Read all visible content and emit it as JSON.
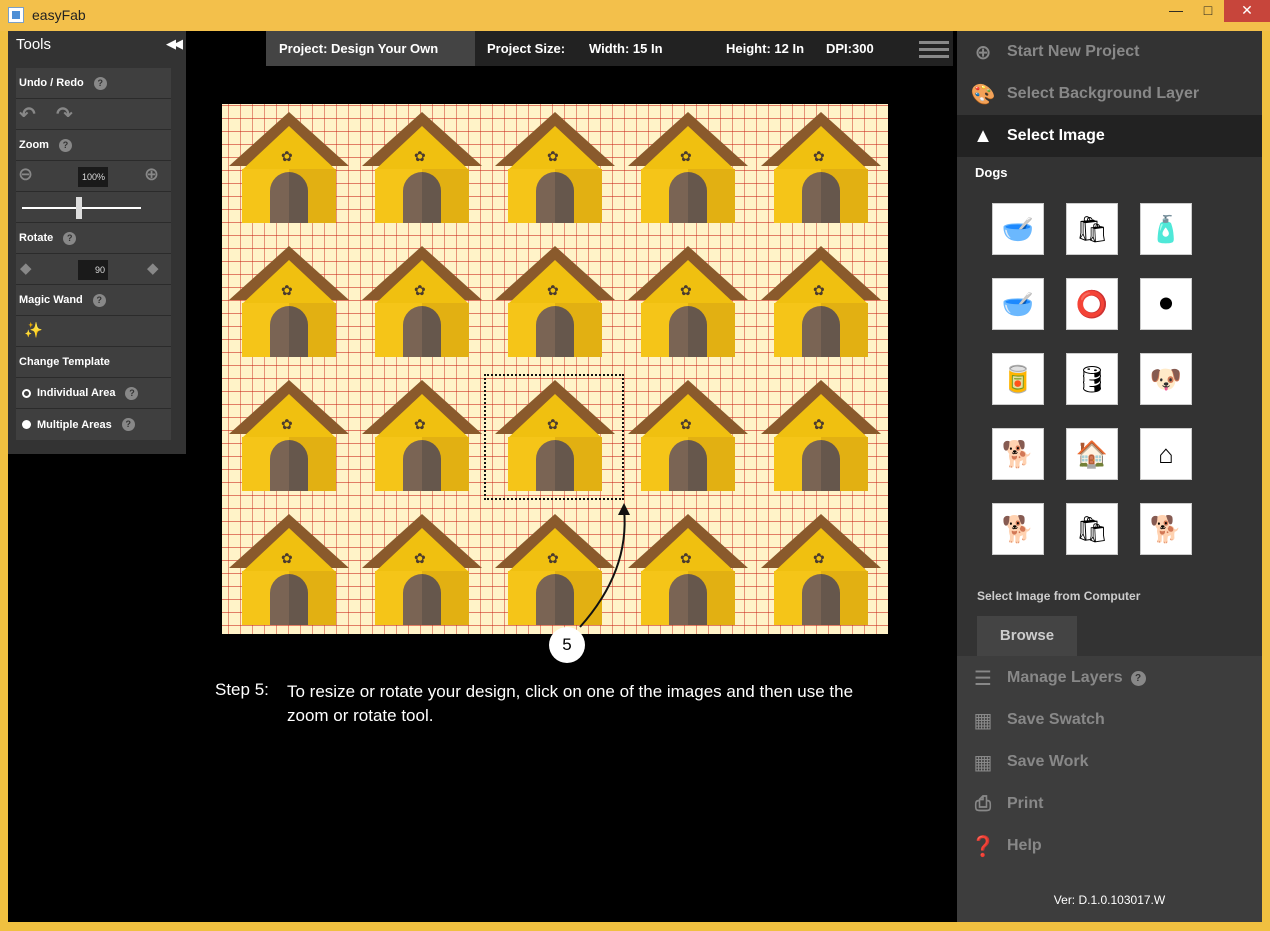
{
  "window": {
    "title": "easyFab"
  },
  "tools": {
    "title": "Tools",
    "undo_redo": "Undo / Redo",
    "zoom": "Zoom",
    "zoom_value": "100%",
    "zoom_level": 0.45,
    "rotate": "Rotate",
    "rotate_value": "90",
    "magic_wand": "Magic Wand",
    "change_template": "Change Template",
    "individual_area": "Individual Area",
    "multiple_areas": "Multiple Areas"
  },
  "infobar": {
    "project": "Project:  Design Your Own",
    "project_size": "Project Size:",
    "width": "Width:  15 In",
    "height": "Height:  12 In",
    "dpi": "DPI:300"
  },
  "step": {
    "number": "5",
    "label": "Step 5:",
    "text": "To resize or rotate your design, click on one of the images and then use the zoom or rotate tool."
  },
  "right_panel": {
    "start_new": "Start New Project",
    "select_bg": "Select Background Layer",
    "select_image": "Select Image",
    "category": "Dogs",
    "select_from_computer": "Select Image from Computer",
    "browse": "Browse",
    "manage_layers": "Manage Layers",
    "save_swatch": "Save Swatch",
    "save_work": "Save Work",
    "print": "Print",
    "help": "Help",
    "version": "Ver: D.1.0.103017.W"
  },
  "thumbnails": [
    {
      "name": "water-bowl-icon",
      "glyph": "🥣"
    },
    {
      "name": "food-bag-icon",
      "glyph": "🛍"
    },
    {
      "name": "medicine-bottle-icon",
      "glyph": "🧴"
    },
    {
      "name": "pink-bowl-icon",
      "glyph": "🥣"
    },
    {
      "name": "red-collar-icon",
      "glyph": "⭕"
    },
    {
      "name": "black-collar-icon",
      "glyph": "⚫"
    },
    {
      "name": "food-can-icon",
      "glyph": "🥫"
    },
    {
      "name": "black-can-icon",
      "glyph": "🛢"
    },
    {
      "name": "dog-face-icon",
      "glyph": "🐶"
    },
    {
      "name": "dog-outline-icon",
      "glyph": "🐕"
    },
    {
      "name": "dog-house-icon",
      "glyph": "🏠"
    },
    {
      "name": "black-house-icon",
      "glyph": "⌂"
    },
    {
      "name": "dog-silhouette-icon",
      "glyph": "🐕"
    },
    {
      "name": "pink-food-bag-icon",
      "glyph": "🛍"
    },
    {
      "name": "dog-profile-icon",
      "glyph": "🐕"
    }
  ]
}
